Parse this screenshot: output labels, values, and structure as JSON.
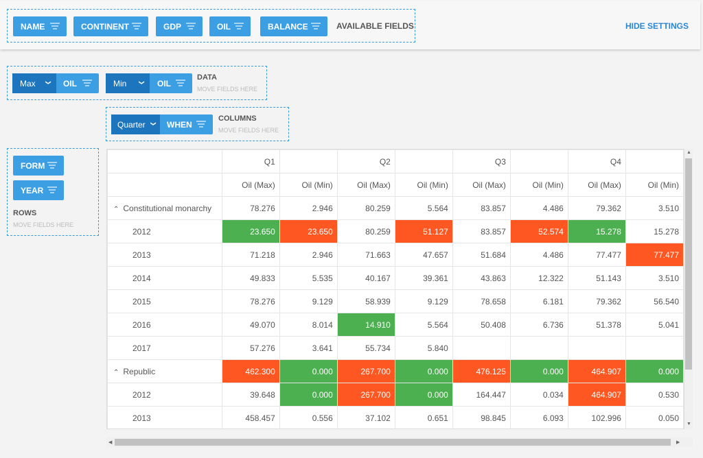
{
  "available_fields": {
    "fields": [
      "NAME",
      "CONTINENT",
      "GDP",
      "OIL",
      "BALANCE"
    ],
    "label": "AVAILABLE FIELDS"
  },
  "hide_settings": "HIDE SETTINGS",
  "data_zone": {
    "items": [
      {
        "agg": "Max",
        "field": "OIL"
      },
      {
        "agg": "Min",
        "field": "OIL"
      }
    ],
    "label": "DATA",
    "hint": "MOVE FIELDS HERE"
  },
  "columns_zone": {
    "agg": "Quarter",
    "field": "WHEN",
    "label": "COLUMNS",
    "hint": "MOVE FIELDS HERE"
  },
  "rows_zone": {
    "fields": [
      "FORM",
      "YEAR"
    ],
    "label": "ROWS",
    "hint": "MOVE FIELDS HERE"
  },
  "colors": {
    "chip": "#3d9fe3",
    "chip_dark": "#1c75bd",
    "max_highlight": "#4caf50",
    "min_highlight": "#ff5722"
  },
  "table": {
    "quarters": [
      "Q1",
      "Q2",
      "Q3",
      "Q4"
    ],
    "measures": [
      "Oil (Max)",
      "Oil (Min)"
    ],
    "rows": [
      {
        "label": "Constitutional monarchy",
        "group": true,
        "cells": [
          "78.276",
          "2.946",
          "80.259",
          "5.564",
          "83.857",
          "4.486",
          "79.362",
          "3.510"
        ],
        "hl": [
          "",
          "",
          "",
          "",
          "",
          "",
          "",
          ""
        ]
      },
      {
        "label": "2012",
        "cells": [
          "23.650",
          "23.650",
          "80.259",
          "51.127",
          "83.857",
          "52.574",
          "15.278",
          "15.278"
        ],
        "hl": [
          "g",
          "o",
          "",
          "o",
          "",
          "o",
          "g",
          ""
        ]
      },
      {
        "label": "2013",
        "cells": [
          "71.218",
          "2.946",
          "71.663",
          "47.657",
          "51.684",
          "4.486",
          "77.477",
          "77.477"
        ],
        "hl": [
          "",
          "",
          "",
          "",
          "",
          "",
          "",
          "o"
        ]
      },
      {
        "label": "2014",
        "cells": [
          "49.833",
          "5.535",
          "40.167",
          "39.361",
          "43.863",
          "12.322",
          "51.143",
          "3.510"
        ],
        "hl": [
          "",
          "",
          "",
          "",
          "",
          "",
          "",
          ""
        ]
      },
      {
        "label": "2015",
        "cells": [
          "78.276",
          "9.129",
          "58.939",
          "9.129",
          "78.658",
          "6.181",
          "79.362",
          "56.540"
        ],
        "hl": [
          "",
          "",
          "",
          "",
          "",
          "",
          "",
          ""
        ]
      },
      {
        "label": "2016",
        "cells": [
          "49.070",
          "8.014",
          "14.910",
          "5.564",
          "50.408",
          "6.736",
          "51.378",
          "5.041"
        ],
        "hl": [
          "",
          "",
          "g",
          "",
          "",
          "",
          "",
          ""
        ]
      },
      {
        "label": "2017",
        "cells": [
          "57.276",
          "3.641",
          "55.734",
          "5.840",
          "",
          "",
          "",
          ""
        ],
        "hl": [
          "",
          "",
          "",
          "",
          "",
          "",
          "",
          ""
        ]
      },
      {
        "label": "Republic",
        "group": true,
        "cells": [
          "462.300",
          "0.000",
          "267.700",
          "0.000",
          "476.125",
          "0.000",
          "464.907",
          "0.000"
        ],
        "hl": [
          "o",
          "g",
          "o",
          "g",
          "o",
          "g",
          "o",
          "g"
        ]
      },
      {
        "label": "2012",
        "cells": [
          "39.648",
          "0.000",
          "267.700",
          "0.000",
          "164.447",
          "0.034",
          "464.907",
          "0.530"
        ],
        "hl": [
          "",
          "g",
          "o",
          "g",
          "",
          "",
          "o",
          ""
        ]
      },
      {
        "label": "2013",
        "cells": [
          "458.457",
          "0.556",
          "37.102",
          "0.651",
          "98.845",
          "6.093",
          "102.996",
          "0.050"
        ],
        "hl": [
          "",
          "",
          "",
          "",
          "",
          "",
          "",
          ""
        ]
      },
      {
        "label": "",
        "cells": [
          "",
          "",
          "",
          "",
          "",
          "",
          "",
          ""
        ],
        "hl": [
          "",
          "",
          "",
          "",
          "",
          "g",
          "",
          ""
        ]
      }
    ]
  }
}
